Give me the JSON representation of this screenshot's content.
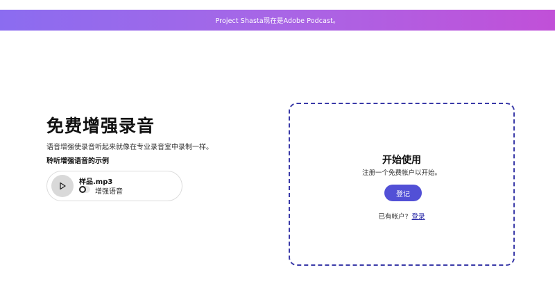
{
  "banner": {
    "text": "Project Shasta现在是Adobe Podcast。"
  },
  "hero": {
    "title": "免费增强录音",
    "subtitle": "语音增强使录音听起来就像在专业录音室中录制一样。",
    "sample_label": "聆听增强语音的示例"
  },
  "player": {
    "file_name": "样品.mp3",
    "toggle_label": "增强语音",
    "toggle_on": false
  },
  "card": {
    "title": "开始使用",
    "subtitle": "注册一个免费帐户以开始。",
    "signup_label": "登记",
    "login_prompt": "已有帐户?",
    "login_link": "登录"
  },
  "colors": {
    "banner_gradient": [
      "#8b6cf0",
      "#c150d8"
    ],
    "accent": "#5250d6",
    "card_border": "#3a3aa8"
  },
  "icons": {
    "play": "play-icon"
  }
}
